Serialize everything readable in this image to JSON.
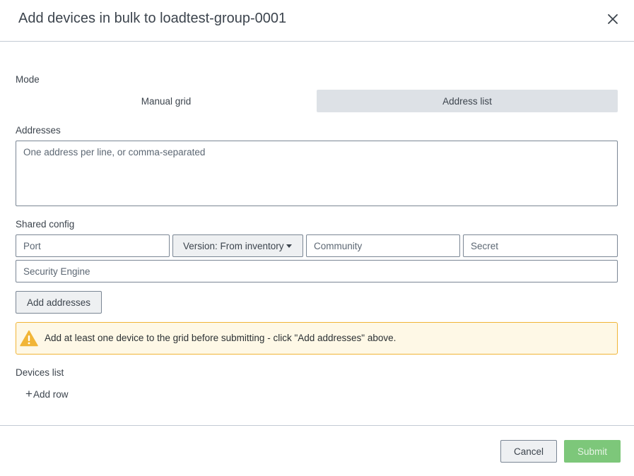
{
  "dialog": {
    "title": "Add devices in bulk to loadtest-group-0001",
    "close_icon": "close-icon"
  },
  "mode": {
    "label": "Mode",
    "options": [
      "Manual grid",
      "Address list"
    ],
    "selected": "Address list"
  },
  "addresses": {
    "label": "Addresses",
    "placeholder": "One address per line, or comma-separated",
    "value": ""
  },
  "shared_config": {
    "label": "Shared config",
    "port_placeholder": "Port",
    "version_label": "Version: From inventory",
    "community_placeholder": "Community",
    "secret_placeholder": "Secret",
    "security_engine_placeholder": "Security Engine"
  },
  "add_addresses_label": "Add addresses",
  "alert": {
    "icon": "warning-icon",
    "message": "Add at least one device to the grid before submitting - click \"Add addresses\" above."
  },
  "devices_list": {
    "label": "Devices list",
    "add_row_icon": "+",
    "add_row_label": "Add row"
  },
  "footer": {
    "cancel_label": "Cancel",
    "submit_label": "Submit",
    "submit_disabled": true
  },
  "colors": {
    "accent_segment": "#dde1e6",
    "alert_border": "#f1b537",
    "alert_background": "#fef8e6",
    "warning_icon": "#f1b537",
    "submit_disabled": "#7dc77a"
  }
}
